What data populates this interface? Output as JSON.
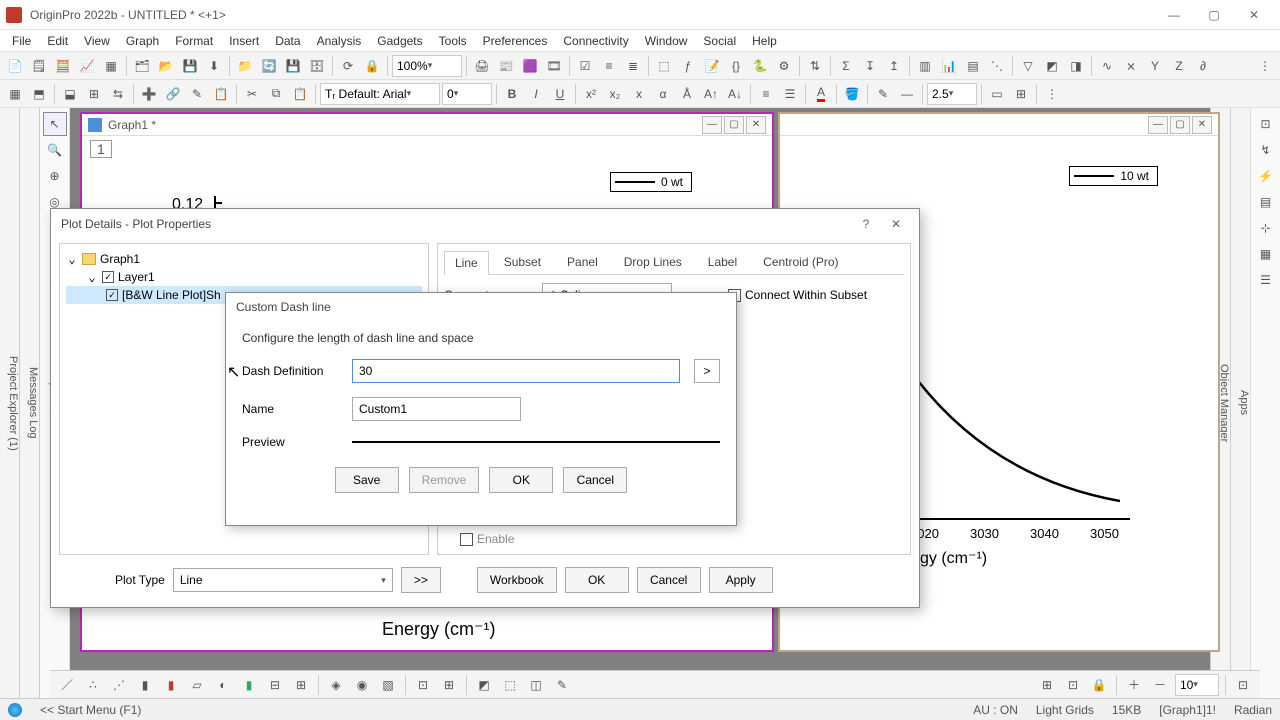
{
  "app": {
    "title": "OriginPro 2022b - UNTITLED * <+1>"
  },
  "menu": [
    "File",
    "Edit",
    "View",
    "Graph",
    "Format",
    "Insert",
    "Data",
    "Analysis",
    "Gadgets",
    "Tools",
    "Preferences",
    "Connectivity",
    "Window",
    "Social",
    "Help"
  ],
  "toolbar2": {
    "zoom": "100%",
    "font_name": "Tᵣ Default: Arial",
    "font_size": "0",
    "linewidth": "2.5"
  },
  "graph_windows": {
    "left": {
      "title": "Graph1 *",
      "page_num": "1",
      "legend": "0 wt",
      "ytick": "0.12",
      "xaxis_label": "Energy (cm⁻¹)"
    },
    "right": {
      "legend": "10 wt",
      "xticks": [
        "3020",
        "3030",
        "3040",
        "3050"
      ],
      "xaxis_label_partial": "gy (cm⁻¹)"
    }
  },
  "plot_details": {
    "title": "Plot Details - Plot Properties",
    "tree": {
      "root": "Graph1",
      "layer": "Layer1",
      "plot": "[B&W Line Plot]Sh"
    },
    "tabs": [
      "Line",
      "Subset",
      "Panel",
      "Drop Lines",
      "Label",
      "Centroid (Pro)"
    ],
    "active_tab": "Line",
    "connect_label": "Connect",
    "connect_value": "Spline",
    "connect_within_subset": "Connect Within Subset",
    "enable_lbl": "Enable",
    "plot_type_label": "Plot Type",
    "plot_type_value": "Line",
    "buttons": {
      "more": ">>",
      "workbook": "Workbook",
      "ok": "OK",
      "cancel": "Cancel",
      "apply": "Apply"
    }
  },
  "custom_dash": {
    "title": "Custom Dash line",
    "subtitle": "Configure the length of dash line and space",
    "dash_def_label": "Dash Definition",
    "dash_def_value": "30",
    "name_label": "Name",
    "name_value": "Custom1",
    "preview_label": "Preview",
    "arrow": ">",
    "buttons": {
      "save": "Save",
      "remove": "Remove",
      "ok": "OK",
      "cancel": "Cancel"
    }
  },
  "status": {
    "left": "<< Start Menu (F1)",
    "au": "AU : ON",
    "grids": "Light Grids",
    "size": "15KB",
    "ctx": "[Graph1]1!",
    "angle": "Radian"
  },
  "bottom_numeric": "10"
}
